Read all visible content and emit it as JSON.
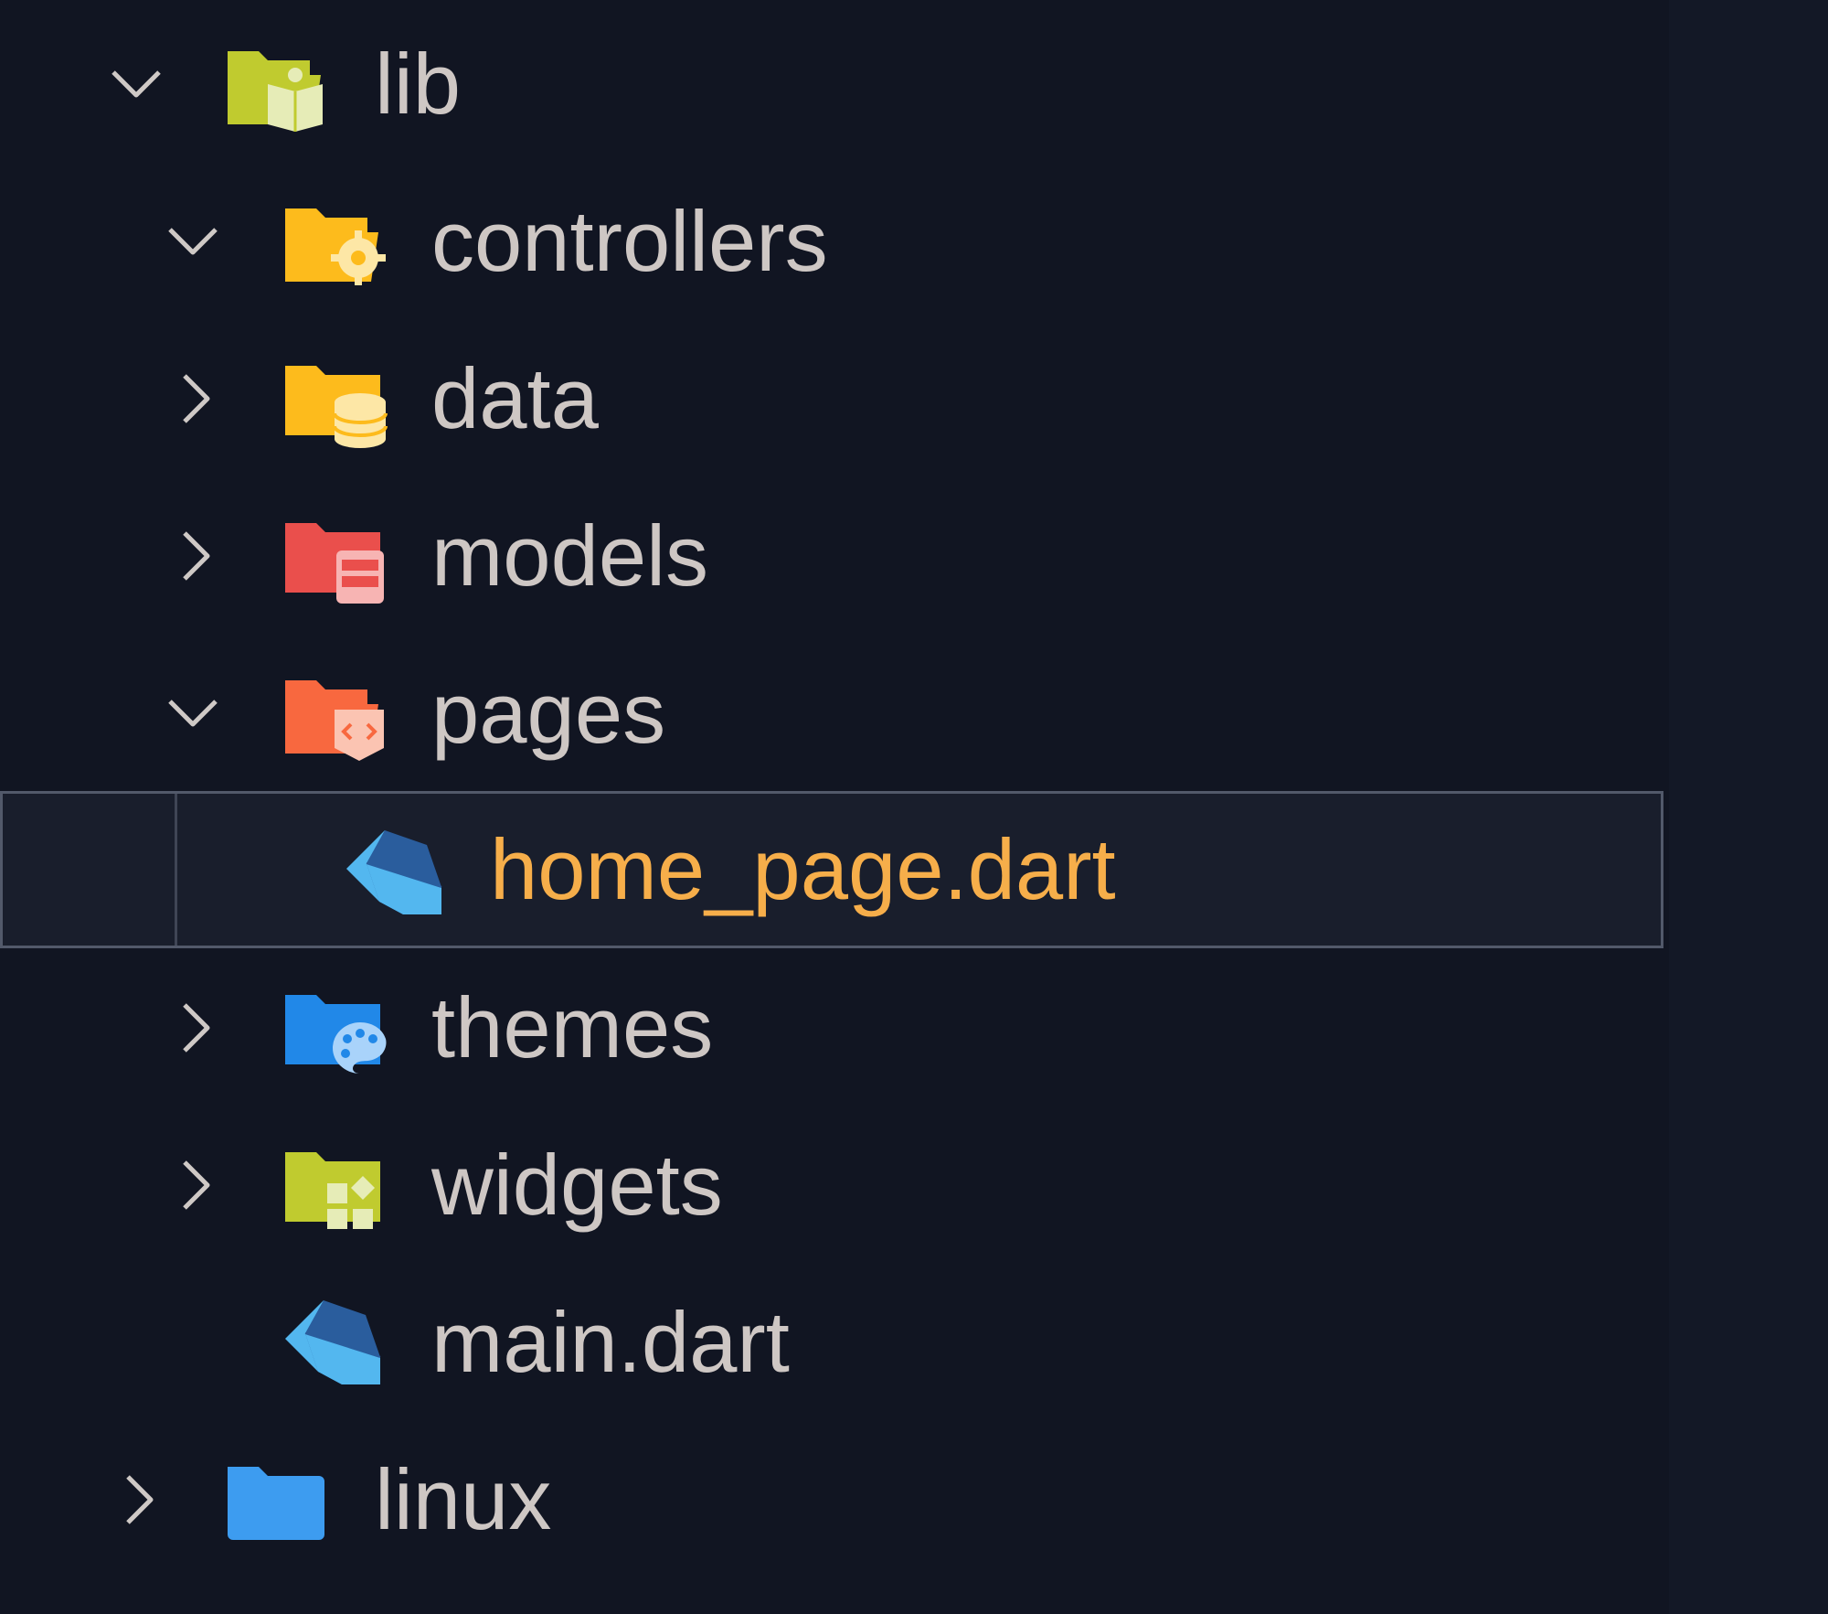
{
  "explorer": {
    "items": [
      {
        "label": "lib",
        "icon": "folder-lib-open-icon",
        "chevron": "chevron-down-icon",
        "expanded": true
      },
      {
        "label": "controllers",
        "icon": "folder-controllers-open-icon",
        "chevron": "chevron-down-icon",
        "expanded": true
      },
      {
        "label": "data",
        "icon": "folder-database-icon",
        "chevron": "chevron-right-icon",
        "expanded": false
      },
      {
        "label": "models",
        "icon": "folder-models-icon",
        "chevron": "chevron-right-icon",
        "expanded": false
      },
      {
        "label": "pages",
        "icon": "folder-pages-open-icon",
        "chevron": "chevron-down-icon",
        "expanded": true
      },
      {
        "label": "home_page.dart",
        "icon": "dart-file-icon",
        "selected": true
      },
      {
        "label": "themes",
        "icon": "folder-themes-icon",
        "chevron": "chevron-right-icon",
        "expanded": false
      },
      {
        "label": "widgets",
        "icon": "folder-widgets-icon",
        "chevron": "chevron-right-icon",
        "expanded": false
      },
      {
        "label": "main.dart",
        "icon": "dart-file-icon"
      },
      {
        "label": "linux",
        "icon": "folder-linux-icon",
        "chevron": "chevron-right-icon",
        "expanded": false
      }
    ]
  },
  "colors": {
    "background": "#111522",
    "text": "#cec7c4",
    "selected_text": "#f6ae4a",
    "selected_border": "#52596a",
    "folder_lib": "#c0cb2f",
    "folder_controllers": "#fdbb1c",
    "folder_data": "#fdbb1c",
    "folder_models": "#ea4f4c",
    "folder_pages": "#f8683f",
    "folder_themes": "#2188e8",
    "folder_widgets": "#c0cb2f",
    "folder_linux": "#3d9cf0",
    "dart_dark": "#2a5d9d",
    "dart_light": "#53b7ef"
  }
}
